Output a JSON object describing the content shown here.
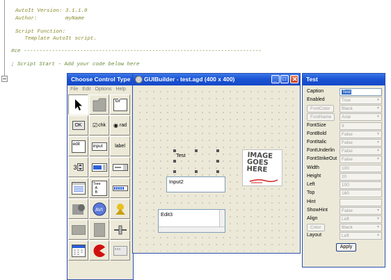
{
  "editor": {
    "lines": [
      {
        "text": "AutoIt Version: 3.1.1.0",
        "color": "#8a8a2a"
      },
      {
        "text": "Author:         myName",
        "color": "#8a8a2a"
      },
      {
        "text": "Script Function:",
        "color": "#8a8a2a"
      },
      {
        "text": "   Template AutoIt script.",
        "color": "#8a8a2a"
      },
      {
        "text": "#ce ----------------------------------------------------------------------------",
        "color": "#6b8a3a"
      },
      {
        "text": "; Script Start - Add your code below here",
        "color": "#6b8a3a"
      }
    ]
  },
  "palette": {
    "title": "Choose Control Type",
    "menu": [
      "File",
      "Edit",
      "Options",
      "Help"
    ],
    "items": [
      {
        "name": "pointer-tool",
        "icon": "arrow-cursor-icon",
        "label": ""
      },
      {
        "name": "tab-control",
        "icon": "tab-page-icon",
        "label": ""
      },
      {
        "name": "group-control",
        "icon": "group-box-icon",
        "label": "Gr"
      },
      {
        "name": "button-control",
        "icon": "button-icon",
        "label": "OK"
      },
      {
        "name": "checkbox-control",
        "icon": "checkbox-icon",
        "label": "chk"
      },
      {
        "name": "radio-control",
        "icon": "radio-icon",
        "label": "rad"
      },
      {
        "name": "edit-control",
        "icon": "edit-box-icon",
        "label": "edit"
      },
      {
        "name": "input-control",
        "icon": "input-box-icon",
        "label": "input"
      },
      {
        "name": "label-control",
        "icon": "label-icon",
        "label": "label"
      },
      {
        "name": "updown-control",
        "icon": "updown-icon",
        "label": "3"
      },
      {
        "name": "date-control",
        "icon": "date-picker-icon",
        "label": ""
      },
      {
        "name": "combo-control",
        "icon": "combobox-icon",
        "label": ""
      },
      {
        "name": "listview-control",
        "icon": "listview-icon",
        "label": ""
      },
      {
        "name": "treeview-control",
        "icon": "treeview-icon",
        "label": "Tree"
      },
      {
        "name": "progress-control",
        "icon": "progress-icon",
        "label": ""
      },
      {
        "name": "icon-control",
        "icon": "icon-picture-icon",
        "label": ""
      },
      {
        "name": "avi-control",
        "icon": "avi-icon",
        "label": ""
      },
      {
        "name": "pic-control",
        "icon": "picture-icon",
        "label": ""
      },
      {
        "name": "graphic-control",
        "icon": "graphic-icon",
        "label": ""
      },
      {
        "name": "bitmap-control",
        "icon": "bitmap-icon",
        "label": ""
      },
      {
        "name": "slider-control",
        "icon": "slider-icon",
        "label": ""
      },
      {
        "name": "calendar-control",
        "icon": "calendar-icon",
        "label": ""
      },
      {
        "name": "pacman-control",
        "icon": "pacman-icon",
        "label": ""
      },
      {
        "name": "statusbar-control",
        "icon": "statusbar-icon",
        "label": ""
      }
    ]
  },
  "builder": {
    "title": "GUIBuilder - test.agd (400 x 400)",
    "controls": {
      "label_text": "Test",
      "input_text": "Input2",
      "edit_text": "Edit3",
      "image_lines": [
        "IMAGE",
        "GOES",
        "HERE"
      ]
    }
  },
  "props": {
    "title": "Test",
    "apply_label": "Apply",
    "rows": [
      {
        "name": "Caption",
        "value": "Test",
        "kind": "text-selected"
      },
      {
        "name": "Enabled",
        "value": "True",
        "kind": "dropdown"
      },
      {
        "name": "",
        "button": "FontColor",
        "value": "Black",
        "kind": "dropdown-button"
      },
      {
        "name": "",
        "button": "FontName",
        "value": "Arial",
        "kind": "dropdown-button"
      },
      {
        "name": "FontSize",
        "value": "9",
        "kind": "text"
      },
      {
        "name": "FontBold",
        "value": "False",
        "kind": "dropdown"
      },
      {
        "name": "FontItalic",
        "value": "False",
        "kind": "dropdown"
      },
      {
        "name": "FontUnderlin",
        "value": "False",
        "kind": "dropdown"
      },
      {
        "name": "FontStrikeOut",
        "value": "False",
        "kind": "dropdown"
      },
      {
        "name": "Width",
        "value": "100",
        "kind": "text"
      },
      {
        "name": "Height",
        "value": "20",
        "kind": "text"
      },
      {
        "name": "Left",
        "value": "100",
        "kind": "text"
      },
      {
        "name": "Top",
        "value": "160",
        "kind": "text"
      },
      {
        "name": "Hint",
        "value": "",
        "kind": "text"
      },
      {
        "name": "ShowHint",
        "value": "False",
        "kind": "dropdown"
      },
      {
        "name": "Align",
        "value": "Left",
        "kind": "dropdown"
      },
      {
        "name": "",
        "button": "Color",
        "value": "Black",
        "kind": "dropdown-button"
      },
      {
        "name": "Layout",
        "value": "Left",
        "kind": "dropdown"
      }
    ]
  },
  "colors": {
    "titlebar": "#1b54d4",
    "window_bg": "#ece9d8",
    "comment": "#8a8a2a",
    "selection": "#316ac5"
  }
}
